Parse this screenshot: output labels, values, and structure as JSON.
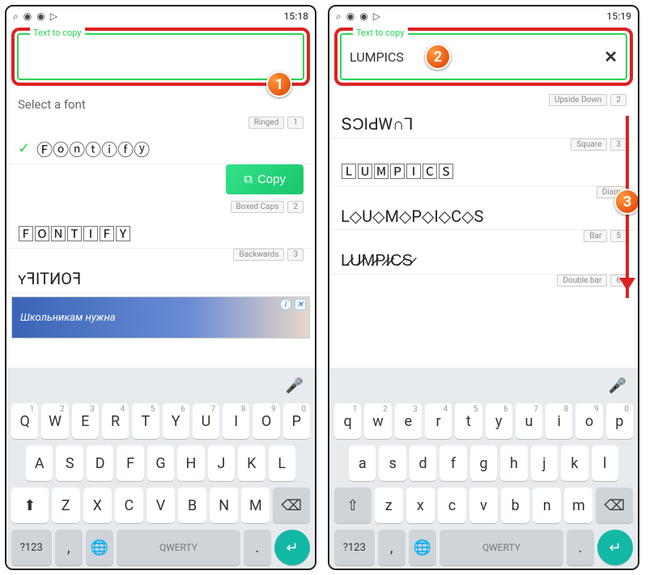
{
  "status": {
    "time": "15:18",
    "time2": "15:19"
  },
  "input": {
    "label": "Text to copy",
    "value_left": "",
    "value_right": "LUMPICS"
  },
  "badges": {
    "b1": "1",
    "b2": "2",
    "b3": "3"
  },
  "left": {
    "select_font": "Select a font",
    "chip1": "Ringed",
    "chip1n": "1",
    "item1": "Ⓕⓞⓝⓣⓘⓕⓨ",
    "copy": "Copy",
    "chip2": "Boxed Caps",
    "chip2n": "2",
    "item2": "🄵🄾🄽🅃🄸🄵🅈",
    "chip3": "Backwards",
    "chip3n": "3",
    "item3": "ʏꟻITИOꟻ",
    "ad": "Школьникам нужна"
  },
  "right": {
    "chip1": "Upside Down",
    "chip1n": "2",
    "item1": "ՏϽIԀW∩⅂",
    "chip2": "Square",
    "chip2n": "3",
    "item2": "🄻🅄🄼🄿🄸🄲🅂",
    "chip3": "Diam",
    "item3": "L◇U◇M◇P◇I◇C◇S",
    "chip4": "Bar",
    "chip4n": "5",
    "item4": "L̷U̷M̷P̷I̷C̷S̷",
    "chip5": "Double bar",
    "chip5n": "6"
  },
  "kbd": {
    "upper": {
      "r1": [
        "Q",
        "W",
        "E",
        "R",
        "T",
        "Y",
        "U",
        "I",
        "O",
        "P"
      ],
      "r2": [
        "A",
        "S",
        "D",
        "F",
        "G",
        "H",
        "J",
        "K",
        "L"
      ],
      "r3": [
        "Z",
        "X",
        "C",
        "V",
        "B",
        "N",
        "M"
      ]
    },
    "lower": {
      "r1": [
        "q",
        "w",
        "e",
        "r",
        "t",
        "y",
        "u",
        "i",
        "o",
        "p"
      ],
      "r2": [
        "a",
        "s",
        "d",
        "f",
        "g",
        "h",
        "j",
        "k",
        "l"
      ],
      "r3": [
        "z",
        "x",
        "c",
        "v",
        "b",
        "n",
        "m"
      ]
    },
    "nums": [
      "1",
      "2",
      "3",
      "4",
      "5",
      "6",
      "7",
      "8",
      "9",
      "0"
    ],
    "mode": "?123",
    "space": "QWERTY",
    "comma": ",",
    "dot": "."
  }
}
